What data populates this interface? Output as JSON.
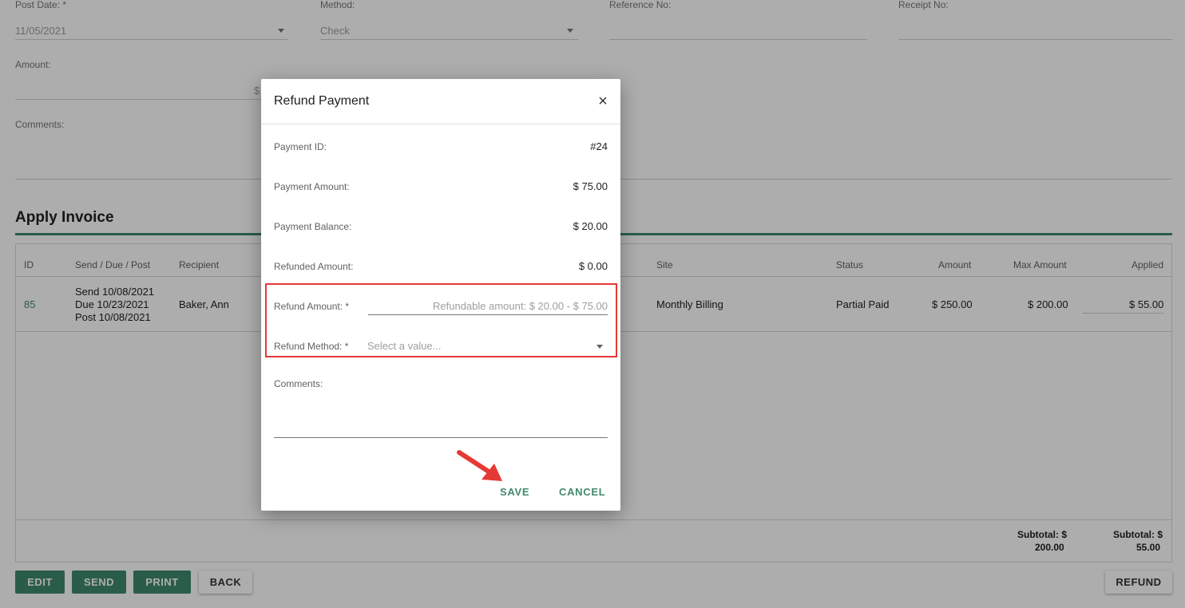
{
  "form": {
    "post_date_label": "Post Date: *",
    "post_date_value": "11/05/2021",
    "method_label": "Method:",
    "method_value": "Check",
    "reference_label": "Reference No:",
    "receipt_label": "Receipt No:",
    "amount_label": "Amount:",
    "amount_prefix": "$",
    "comments_label": "Comments:"
  },
  "apply_invoice": {
    "title": "Apply Invoice",
    "columns": [
      "ID",
      "Send / Due / Post",
      "Recipient",
      "Site",
      "Status",
      "Amount",
      "Max Amount",
      "Applied"
    ],
    "row": {
      "id": "85",
      "send": "Send 10/08/2021",
      "due": "Due 10/23/2021",
      "post": "Post 10/08/2021",
      "recipient": "Baker, Ann",
      "site": "Monthly Billing",
      "status": "Partial Paid",
      "amount": "$ 250.00",
      "max_amount": "$ 200.00",
      "applied": "$ 55.00"
    },
    "subtotal_max_line1": "Subtotal: $",
    "subtotal_max_line2": "200.00",
    "subtotal_applied_line1": "Subtotal: $",
    "subtotal_applied_line2": "55.00"
  },
  "actions": {
    "edit": "EDIT",
    "send": "SEND",
    "print": "PRINT",
    "back": "BACK",
    "refund": "REFUND"
  },
  "modal": {
    "title": "Refund Payment",
    "close_icon": "×",
    "payment_id_label": "Payment ID:",
    "payment_id_value": "#24",
    "payment_amount_label": "Payment Amount:",
    "payment_amount_value": "$ 75.00",
    "payment_balance_label": "Payment Balance:",
    "payment_balance_value": "$ 20.00",
    "refunded_amount_label": "Refunded Amount:",
    "refunded_amount_value": "$ 0.00",
    "refund_amount_label": "Refund Amount: *",
    "refund_amount_placeholder": "Refundable amount: $ 20.00 - $ 75.00",
    "refund_method_label": "Refund Method: *",
    "refund_method_placeholder": "Select a value...",
    "comments_label": "Comments:",
    "save": "SAVE",
    "cancel": "CANCEL"
  },
  "colors": {
    "accent": "#3f8a6c",
    "highlight": "#e53935"
  }
}
